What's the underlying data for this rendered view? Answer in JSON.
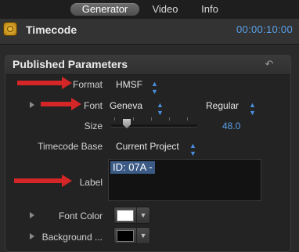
{
  "tabs": [
    {
      "label": "Generator",
      "active": true
    },
    {
      "label": "Video",
      "active": false
    },
    {
      "label": "Info",
      "active": false
    }
  ],
  "header": {
    "title": "Timecode",
    "icon": "generator-icon",
    "timecode": "00:00:10:00"
  },
  "panel": {
    "title": "Published Parameters",
    "reset_icon": "reset-arrow-icon"
  },
  "params": {
    "format": {
      "label": "Format",
      "value": "HMSF"
    },
    "font": {
      "label": "Font",
      "value": "Geneva",
      "style": "Regular"
    },
    "size": {
      "label": "Size",
      "value": "48.0",
      "level_fraction": 0.15
    },
    "timecode_base": {
      "label": "Timecode Base",
      "value": "Current Project"
    },
    "label": {
      "label": "Label",
      "value": "ID: 07A - "
    },
    "font_color": {
      "label": "Font Color",
      "color": "#ffffff"
    },
    "background": {
      "label": "Background ...",
      "color": "#000000"
    }
  },
  "colors": {
    "accent": "#5aa0e8",
    "annotation_arrow": "#d42626",
    "selection": "#3b5b86"
  }
}
